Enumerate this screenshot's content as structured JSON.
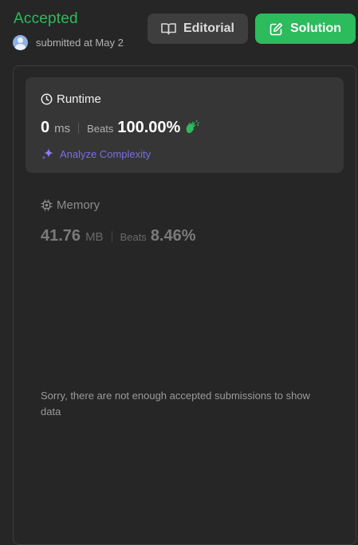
{
  "header": {
    "status": "Accepted",
    "submitted_text": "submitted at May 2",
    "editorial_label": "Editorial",
    "solution_label": "Solution"
  },
  "runtime": {
    "heading": "Runtime",
    "value": "0",
    "unit": "ms",
    "beats_label": "Beats",
    "beats_value": "100.00%",
    "analyze_label": "Analyze Complexity"
  },
  "memory": {
    "heading": "Memory",
    "value": "41.76",
    "unit": "MB",
    "beats_label": "Beats",
    "beats_value": "8.46%"
  },
  "notice": "Sorry, there are not enough accepted submissions to show data",
  "colors": {
    "accepted_green": "#2cbb5d",
    "analyze_purple": "#7a6de0",
    "background": "#262626"
  },
  "icons": {
    "avatar": "user-avatar",
    "editorial": "book-icon",
    "solution": "edit-icon",
    "runtime": "clock-icon",
    "beats": "clap-icon",
    "analyze": "sparkle-icon",
    "memory": "chip-icon"
  }
}
